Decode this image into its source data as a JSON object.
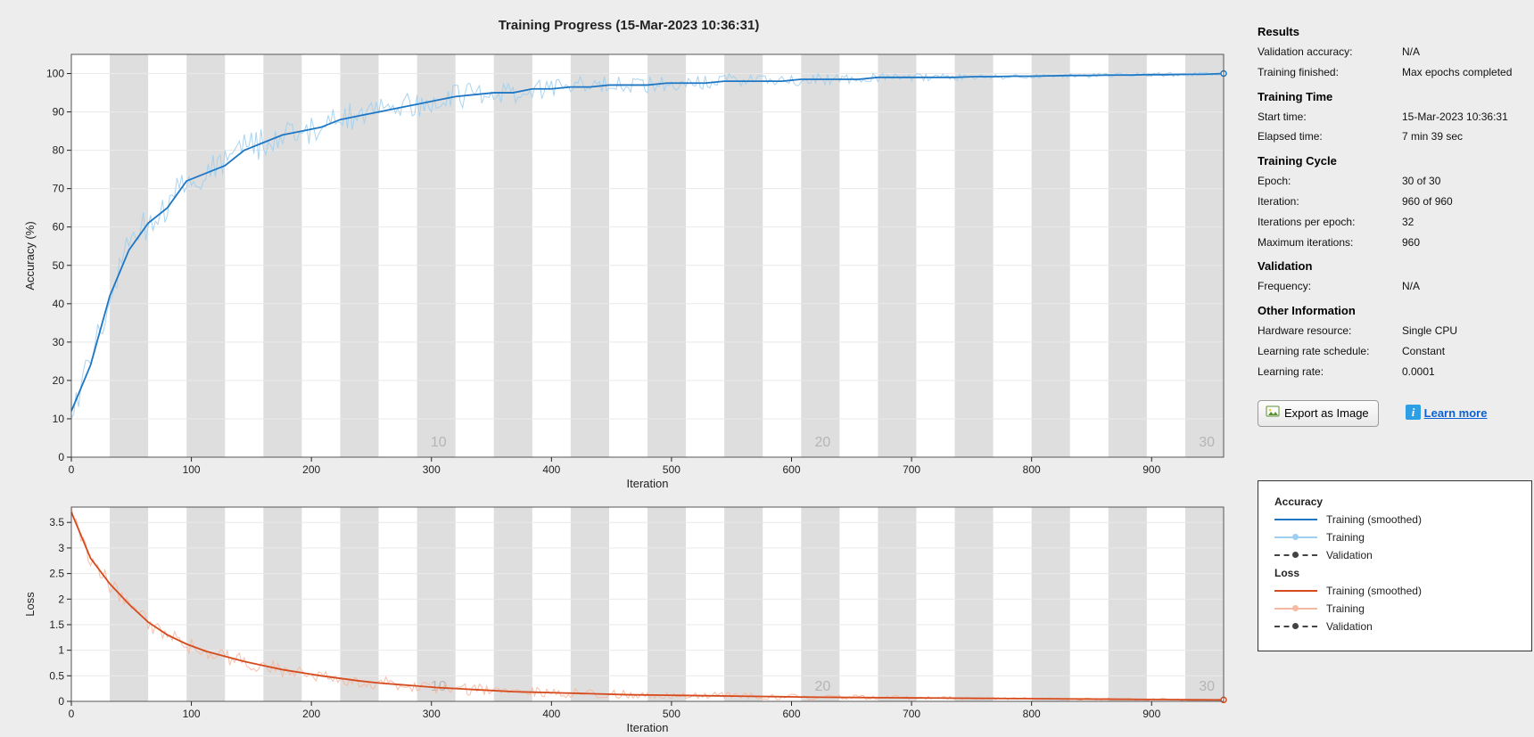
{
  "title": "Training Progress (15-Mar-2023 10:36:31)",
  "info": {
    "results_h": "Results",
    "val_acc_lbl": "Validation accuracy:",
    "val_acc_val": "N/A",
    "train_fin_lbl": "Training finished:",
    "train_fin_val": "Max epochs completed",
    "time_h": "Training Time",
    "start_lbl": "Start time:",
    "start_val": "15-Mar-2023 10:36:31",
    "elapsed_lbl": "Elapsed time:",
    "elapsed_val": "7 min 39 sec",
    "cycle_h": "Training Cycle",
    "epoch_lbl": "Epoch:",
    "epoch_val": "30 of 30",
    "iter_lbl": "Iteration:",
    "iter_val": "960 of 960",
    "ipe_lbl": "Iterations per epoch:",
    "ipe_val": "32",
    "maxiter_lbl": "Maximum iterations:",
    "maxiter_val": "960",
    "valid_h": "Validation",
    "freq_lbl": "Frequency:",
    "freq_val": "N/A",
    "other_h": "Other Information",
    "hw_lbl": "Hardware resource:",
    "hw_val": "Single CPU",
    "lrs_lbl": "Learning rate schedule:",
    "lrs_val": "Constant",
    "lr_lbl": "Learning rate:",
    "lr_val": "0.0001"
  },
  "actions": {
    "export_label": "Export as Image",
    "learn_label": "Learn more"
  },
  "legend": {
    "acc_h": "Accuracy",
    "loss_h": "Loss",
    "train_sm": "Training (smoothed)",
    "train": "Training",
    "valid": "Validation"
  },
  "chart_data": [
    {
      "type": "line",
      "title": "Accuracy (%) vs Iteration",
      "xlabel": "Iteration",
      "ylabel": "Accuracy (%)",
      "xlim": [
        0,
        960
      ],
      "ylim": [
        0,
        105
      ],
      "y_ticks": [
        0,
        10,
        20,
        30,
        40,
        50,
        60,
        70,
        80,
        90,
        100
      ],
      "x_ticks": [
        0,
        100,
        200,
        300,
        400,
        500,
        600,
        700,
        800,
        900
      ],
      "epoch_markers": {
        "step": 32,
        "count": 30,
        "labels_at": [
          10,
          20,
          30
        ]
      },
      "series": [
        {
          "name": "Training (smoothed)",
          "color": "#1f77c4",
          "x": [
            0,
            16,
            32,
            48,
            64,
            80,
            96,
            112,
            128,
            144,
            160,
            176,
            192,
            208,
            224,
            240,
            256,
            272,
            288,
            304,
            320,
            336,
            352,
            368,
            384,
            400,
            416,
            432,
            448,
            464,
            480,
            496,
            512,
            528,
            544,
            560,
            576,
            592,
            608,
            624,
            640,
            656,
            672,
            688,
            704,
            720,
            736,
            752,
            768,
            784,
            800,
            816,
            832,
            848,
            864,
            880,
            896,
            912,
            928,
            944,
            960
          ],
          "values": [
            12,
            24,
            42,
            54,
            61,
            65,
            72,
            74,
            76,
            80,
            82,
            84,
            85,
            86,
            88,
            89,
            90,
            91,
            92,
            93,
            94,
            94.5,
            95,
            95,
            96,
            96,
            96.5,
            96.5,
            97,
            97,
            97,
            97.5,
            97.5,
            97.5,
            98,
            98,
            98,
            98,
            98.5,
            98.5,
            98.5,
            98.5,
            99,
            99,
            99,
            99,
            99,
            99.2,
            99.2,
            99.3,
            99.3,
            99.4,
            99.5,
            99.5,
            99.6,
            99.6,
            99.7,
            99.7,
            99.8,
            99.8,
            100
          ]
        },
        {
          "name": "Training",
          "color": "#9ecff0",
          "x": [
            0,
            8,
            16,
            24,
            32,
            40,
            48,
            56,
            64,
            72,
            80,
            88,
            96,
            104,
            112,
            120,
            128,
            136,
            144,
            152,
            160,
            168,
            176,
            184,
            192,
            200,
            208,
            216,
            224,
            232,
            240,
            248,
            256,
            264,
            272,
            280,
            288,
            296,
            304,
            312,
            320,
            336,
            352,
            368,
            384,
            400,
            432,
            464,
            496,
            528,
            560,
            592,
            624,
            656,
            688,
            720,
            752,
            784,
            816,
            848,
            880,
            912,
            944,
            960
          ],
          "values": [
            12,
            18,
            25,
            33,
            41,
            48,
            53,
            57,
            60,
            62,
            64,
            67,
            70,
            72,
            73,
            74,
            75,
            77,
            78,
            80,
            81,
            82,
            83,
            84,
            85,
            86,
            86,
            87,
            88,
            88,
            89,
            90,
            90,
            91,
            91,
            92,
            92,
            93,
            93,
            94,
            94,
            95,
            95,
            95,
            96,
            96,
            97,
            97,
            97,
            98,
            98,
            98,
            98,
            98,
            98,
            99,
            99,
            99,
            99,
            99,
            99,
            100,
            100,
            100
          ],
          "noise_amp": 5
        }
      ]
    },
    {
      "type": "line",
      "title": "Loss vs Iteration",
      "xlabel": "Iteration",
      "ylabel": "Loss",
      "xlim": [
        0,
        960
      ],
      "ylim": [
        0,
        3.8
      ],
      "y_ticks": [
        0,
        0.5,
        1,
        1.5,
        2,
        2.5,
        3,
        3.5
      ],
      "x_ticks": [
        0,
        100,
        200,
        300,
        400,
        500,
        600,
        700,
        800,
        900
      ],
      "epoch_markers": {
        "step": 32,
        "count": 30,
        "labels_at": [
          10,
          20,
          30
        ]
      },
      "series": [
        {
          "name": "Training (smoothed)",
          "color": "#d64b1d",
          "x": [
            0,
            16,
            32,
            48,
            64,
            80,
            96,
            112,
            128,
            144,
            160,
            176,
            192,
            208,
            224,
            240,
            256,
            272,
            288,
            304,
            320,
            336,
            352,
            368,
            384,
            400,
            432,
            464,
            496,
            528,
            560,
            592,
            624,
            656,
            688,
            720,
            752,
            784,
            816,
            848,
            880,
            912,
            944,
            960
          ],
          "values": [
            3.7,
            2.8,
            2.3,
            1.9,
            1.55,
            1.3,
            1.12,
            0.98,
            0.88,
            0.78,
            0.7,
            0.62,
            0.56,
            0.5,
            0.45,
            0.4,
            0.36,
            0.33,
            0.3,
            0.27,
            0.25,
            0.23,
            0.21,
            0.19,
            0.18,
            0.17,
            0.15,
            0.13,
            0.12,
            0.11,
            0.1,
            0.09,
            0.08,
            0.075,
            0.07,
            0.065,
            0.06,
            0.055,
            0.05,
            0.045,
            0.04,
            0.035,
            0.03,
            0.028
          ]
        },
        {
          "name": "Training",
          "color": "#f5b8a0",
          "noise_amp": 0.18
        }
      ]
    }
  ]
}
